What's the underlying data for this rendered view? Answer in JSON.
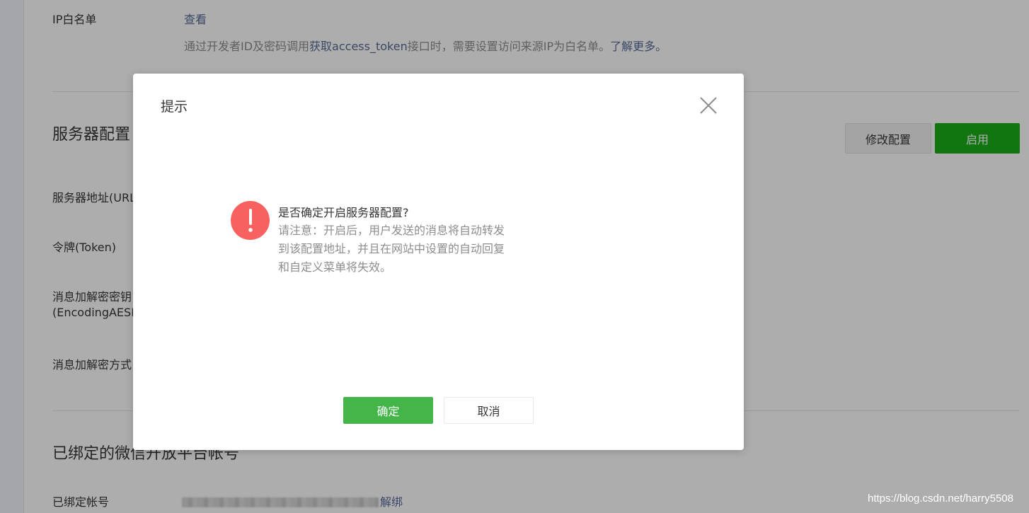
{
  "background": {
    "ip_whitelist": {
      "label": "IP白名单",
      "view_link": "查看",
      "desc_prefix": "通过开发者ID及密码调用",
      "desc_link": "获取access_token",
      "desc_suffix": "接口时，需要设置访问来源IP为白名单。",
      "learn_more": "了解更多。"
    },
    "server_config": {
      "title": "服务器配置",
      "modify_button": "修改配置",
      "enable_button": "启用",
      "fields": {
        "url": "服务器地址(URL)",
        "token": "令牌(Token)",
        "aes_line1": "消息加解密密钥",
        "aes_line2": "(EncodingAESKey)",
        "mode": "消息加解密方式"
      }
    },
    "bound_accounts": {
      "title": "已绑定的微信开放平台帐号",
      "account_label": "已绑定帐号",
      "unbind_link": "解绑"
    },
    "watermark": "https://blog.csdn.net/harry5508"
  },
  "dialog": {
    "title": "提示",
    "message_title": "是否确定开启服务器配置?",
    "message_body": "请注意：开启后，用户发送的消息将自动转发到该配置地址，并且在网站中设置的自动回复和自定义菜单将失效。",
    "confirm_button": "确定",
    "cancel_button": "取消"
  },
  "colors": {
    "primary_green": "#1aad19",
    "confirm_green": "#44b549",
    "warning_red": "#f76260",
    "link_blue": "#576b95"
  },
  "icons": {
    "close": "close-icon",
    "warning": "exclamation-icon"
  }
}
